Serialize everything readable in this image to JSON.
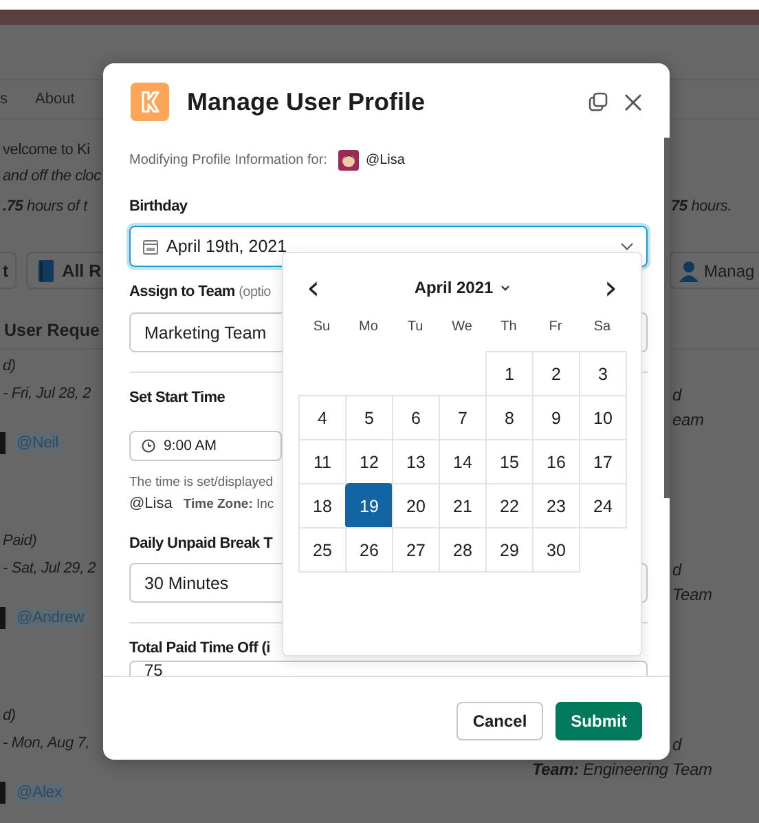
{
  "background_page": {
    "nav_tabs": [
      "s",
      "About"
    ],
    "welcome_lines": [
      "velcome to Ki",
      "and off the cloc"
    ],
    "hours_line": "**.75** hours of t",
    "hours_summary": "**75** hours.",
    "toolbar_buttons": [
      {
        "label": "t"
      },
      {
        "label": "All R"
      }
    ],
    "manage_button": {
      "label": "Manag"
    },
    "section_title": "User Reque",
    "requests": [
      {
        "status": "d)",
        "dates": "- Fri, Jul 28, 2",
        "user": "@Neil",
        "right_lines": [
          {
            "kind": "fragment",
            "text": "d"
          },
          {
            "kind": "fragment",
            "text": "eam"
          }
        ]
      },
      {
        "status": "Paid)",
        "dates": "- Sat, Jul 29, 2",
        "user": "@Andrew",
        "right_lines": [
          {
            "kind": "fragment",
            "text": "d"
          },
          {
            "kind": "fragment",
            "text": "Team"
          }
        ]
      },
      {
        "status": "d)",
        "dates": "- Mon, Aug 7,",
        "user": "@Alex",
        "right_lines": [
          {
            "kind": "fragment",
            "text": "d"
          },
          {
            "kind": "full",
            "text": "**Team:** Engineering Team"
          }
        ]
      }
    ]
  },
  "dialog": {
    "title": "Manage User Profile",
    "subject": {
      "label": "Modifying Profile Information for:",
      "user": "@Lisa"
    },
    "birthday": {
      "label": "Birthday",
      "value": "April 19th, 2021",
      "focused": true
    },
    "team": {
      "label": "Assign to Team",
      "hint": "(optio",
      "value": "Marketing Team"
    },
    "start_time": {
      "label": "Set Start Time",
      "value": "9:00 AM",
      "note": "The time is set/displayed",
      "user": "@Lisa",
      "timezone_label": "Time Zone:",
      "timezone_value": "Inc"
    },
    "break_time": {
      "label": "Daily Unpaid Break T",
      "value": "30 Minutes"
    },
    "paid_time_off": {
      "label": "Total Paid Time Off (i",
      "value": "75"
    },
    "calendar": {
      "month": "April 2021",
      "prev": "‹",
      "next": "›",
      "weekdays": [
        "Su",
        "Mo",
        "Tu",
        "We",
        "Th",
        "Fr",
        "Sa"
      ],
      "weeks": [
        {
          "kind": "leading",
          "days": [
            {
              "label": "1",
              "selected": false
            },
            {
              "label": "2",
              "selected": false
            },
            {
              "label": "3",
              "selected": false
            }
          ]
        },
        {
          "kind": "full",
          "days": [
            {
              "label": "4",
              "selected": false
            },
            {
              "label": "5",
              "selected": false
            },
            {
              "label": "6",
              "selected": false
            },
            {
              "label": "7",
              "selected": false
            },
            {
              "label": "8",
              "selected": false
            },
            {
              "label": "9",
              "selected": false
            },
            {
              "label": "10",
              "selected": false
            }
          ]
        },
        {
          "kind": "full",
          "days": [
            {
              "label": "11",
              "selected": false
            },
            {
              "label": "12",
              "selected": false
            },
            {
              "label": "13",
              "selected": false
            },
            {
              "label": "14",
              "selected": false
            },
            {
              "label": "15",
              "selected": false
            },
            {
              "label": "16",
              "selected": false
            },
            {
              "label": "17",
              "selected": false
            }
          ]
        },
        {
          "kind": "full",
          "days": [
            {
              "label": "18",
              "selected": false
            },
            {
              "label": "19",
              "selected": true
            },
            {
              "label": "20",
              "selected": false
            },
            {
              "label": "21",
              "selected": false
            },
            {
              "label": "22",
              "selected": false
            },
            {
              "label": "23",
              "selected": false
            },
            {
              "label": "24",
              "selected": false
            }
          ]
        },
        {
          "kind": "trailing",
          "days": [
            {
              "label": "25",
              "selected": false
            },
            {
              "label": "26",
              "selected": false
            },
            {
              "label": "27",
              "selected": false
            },
            {
              "label": "28",
              "selected": false
            },
            {
              "label": "29",
              "selected": false
            },
            {
              "label": "30",
              "selected": false
            }
          ]
        }
      ]
    },
    "buttons": [
      {
        "label": "Cancel",
        "kind": "secondary"
      },
      {
        "label": "Submit",
        "kind": "primary"
      }
    ]
  }
}
